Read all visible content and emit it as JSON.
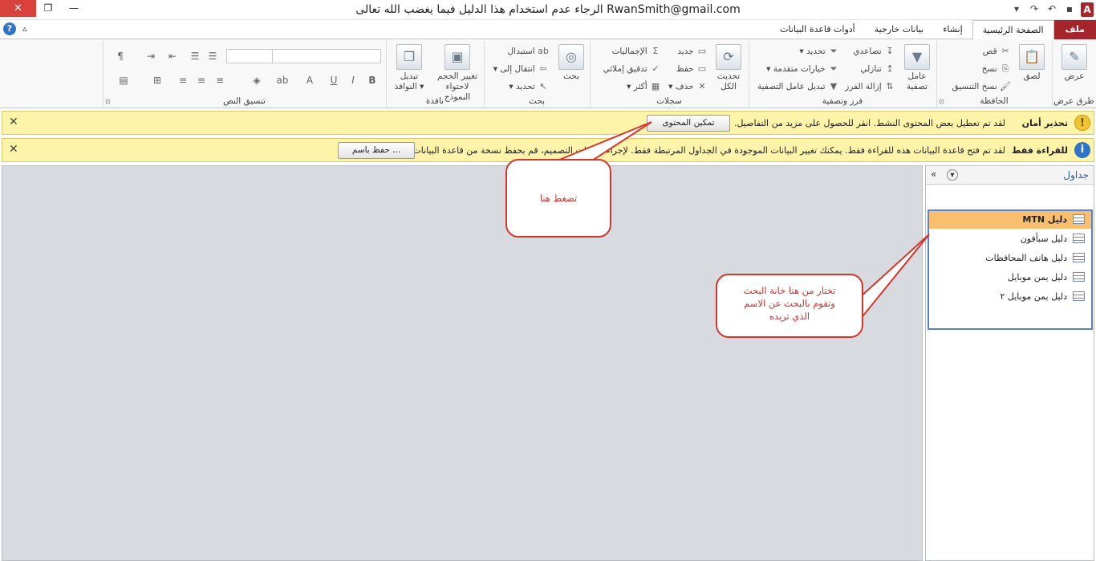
{
  "window": {
    "title": "RwanSmith@gmail.com  الرجاء عدم استخدام هذا الدليل فيما يغضب الله تعالى",
    "app_logo": "A",
    "close_glyph": "✕"
  },
  "tabs": [
    {
      "label": "ملف"
    },
    {
      "label": "الصفحة الرئيسية"
    },
    {
      "label": "إنشاء"
    },
    {
      "label": "بيانات خارجية"
    },
    {
      "label": "أدوات قاعدة البيانات"
    }
  ],
  "ribbon": {
    "groups": {
      "views": {
        "label": "طرق عرض",
        "view": "عرض"
      },
      "clipboard": {
        "label": "الحافظة",
        "paste": "لصق",
        "cut": "قص",
        "copy": "نسخ",
        "format_painter": "نسخ التنسيق"
      },
      "sort_filter": {
        "label": "فرز وتصفية",
        "filter": "عامل تصفية",
        "ascending": "تصاعدي",
        "descending": "تنازلي",
        "remove_sort": "إزالة الفرز",
        "selection": "تحديد",
        "advanced": "خيارات متقدمة",
        "toggle_filter": "تبديل عامل التصفية"
      },
      "records": {
        "label": "سجلات",
        "refresh_all": "تحديث الكل",
        "new": "جديد",
        "save": "حفظ",
        "delete": "حذف",
        "totals": "الإجماليات",
        "spelling": "تدقيق إملائي",
        "more": "أكثر"
      },
      "find": {
        "label": "بحث",
        "find": "بحث",
        "replace": "استبدال",
        "goto": "انتقال إلى",
        "select": "تحديد"
      },
      "window": {
        "label": "نافذة",
        "size_to_fit": "تغيير الحجم لاحتواء النموذج",
        "switch_windows": "تبديل النوافذ"
      },
      "text_formatting": {
        "label": "تنسيق النص"
      }
    }
  },
  "security_bar": {
    "title": "تحذير أمان",
    "text": "لقد تم تعطيل بعض المحتوى النشط. انقر للحصول على مزيد من التفاصيل.",
    "button": "تمكين المحتوى",
    "close": "✕"
  },
  "readonly_bar": {
    "title": "للقراءة فقط",
    "text": "لقد تم فتح قاعدة البيانات هذه للقراءة فقط. يمكنك تغيير البيانات الموجودة في الجداول المرتبطة فقط. لإجراء تغييرات التصميم، قم بحفظ نسخة من قاعدة البيانات.",
    "button": "حفظ باسم ...",
    "close": "✕"
  },
  "nav_pane": {
    "title": "جداول",
    "shutter": "«",
    "items": [
      {
        "name": "دليل MTN",
        "selected": true
      },
      {
        "name": "دليل سبأفون",
        "selected": false
      },
      {
        "name": "دليل هاتف المحافظات",
        "selected": false
      },
      {
        "name": "دليل يمن موبايل",
        "selected": false
      },
      {
        "name": "دليل يمن موبايل ٢",
        "selected": false
      }
    ]
  },
  "callouts": {
    "click_here": "تضغط هنا",
    "search_hint": "تختار من هنا خانة البحث وتقوم بالبحث عن الاسم الذي تريده"
  },
  "colors": {
    "file_tab": "#a4262c",
    "message_bar": "#fdf3a9",
    "nav_selected": "#f9be6e",
    "callout_red": "#d7362c"
  }
}
